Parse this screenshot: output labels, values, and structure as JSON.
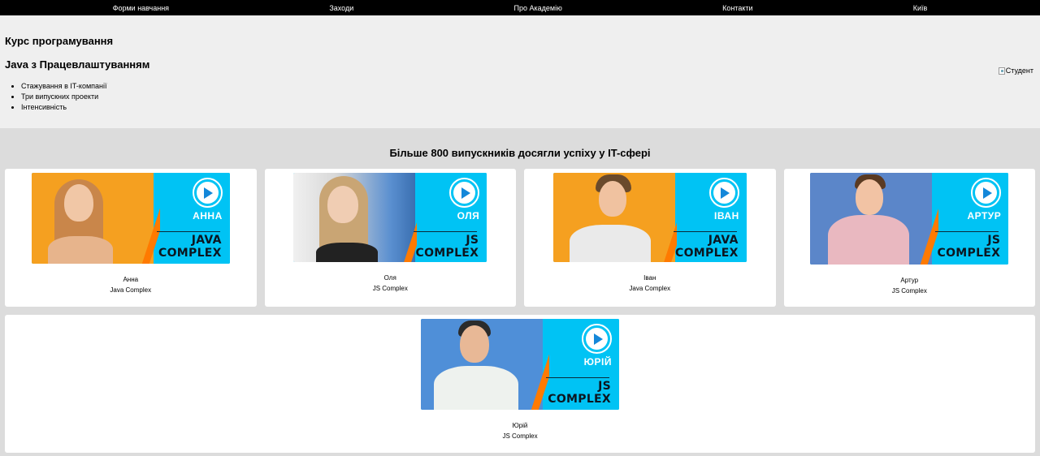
{
  "nav": [
    "Форми навчання",
    "Заходи",
    "Про Академію",
    "Контакти",
    "Київ"
  ],
  "hero": {
    "title": "Курс програмування",
    "subtitle": "Java з Працевлаштуванням",
    "bullets": [
      "Стажування в IT-компанії",
      "Три випускних проекти",
      "Інтенсивність"
    ],
    "image_alt": "Студент"
  },
  "graduates": {
    "title": "Більше 800 випускників досягли успіху у IT-сфері",
    "items": [
      {
        "name": "Анна",
        "course": "Java Complex",
        "thumb_name": "АННА",
        "thumb_course_1": "JAVA",
        "thumb_course_2": "COMPLEX"
      },
      {
        "name": "Оля",
        "course": "JS Complex",
        "thumb_name": "ОЛЯ",
        "thumb_course_1": "JS",
        "thumb_course_2": "COMPLEX"
      },
      {
        "name": "Іван",
        "course": "Java Complex",
        "thumb_name": "ІВАН",
        "thumb_course_1": "JAVA",
        "thumb_course_2": "COMPLEX"
      },
      {
        "name": "Артур",
        "course": "JS Complex",
        "thumb_name": "АРТУР",
        "thumb_course_1": "JS",
        "thumb_course_2": "COMPLEX"
      },
      {
        "name": "Юрій",
        "course": "JS Complex",
        "thumb_name": "ЮРІЙ",
        "thumb_course_1": "JS",
        "thumb_course_2": "COMPLEX"
      }
    ]
  },
  "colors": {
    "accent_cyan": "#00c3f4",
    "accent_orange": "#ff7a00",
    "nav_bg": "#000000"
  }
}
